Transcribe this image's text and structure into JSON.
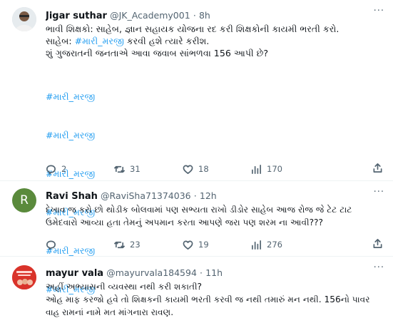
{
  "tweets": [
    {
      "name": "Jigar suthar",
      "handle": "@JK_Academy001",
      "dot": "·",
      "time": "8h",
      "more": "···",
      "lines": [
        "ભાવી શિક્ષકો: સાહેબ, જ્ઞાન સહાયક યોજના રદ કરી શિક્ષકોની કાયમી ભરતી કરો.",
        "શું ગુજરાતની જનતાએ આવા જવાબ સાંભળવા 156 આપી છે?"
      ],
      "line2_prefix": "સાહેબ: ",
      "line2_tag": "#મારી_મરજી",
      "line2_suffix": " કરવી હશે ત્યારે કરીશ.",
      "hashtags": [
        "#મારી_મરજી",
        "#મારી_મરજી",
        "#મારી_મરજી",
        "#મારી_મરજી",
        "#મારી_મરજી",
        "#મારી_મરજી"
      ],
      "replies": "2",
      "retweets": "31",
      "likes": "18",
      "views": "170"
    },
    {
      "name": "Ravi Shah",
      "handle": "@RaviSha71374036",
      "dot": "·",
      "time": "12h",
      "more": "···",
      "avatar_letter": "R",
      "avatar_color": "#5a8a3c",
      "text": "દેખાવ જ કરો છો થોડીક બોલવામાં પણ સભ્યતા રાખો ડીડોર સાહેબ આજ રોજ જે ટેટ ટાટ ઉમેદવારો આવ્યા હતા તેમનું અપમાન કરતા આપણે જરા પણ શરમ ના આવી???",
      "replies": "",
      "retweets": "23",
      "likes": "19",
      "views": "276"
    },
    {
      "name": "mayur vala",
      "handle": "@mayurvala184594",
      "dot": "·",
      "time": "11h",
      "more": "···",
      "avatar_color": "#e0342b",
      "text": "અહીં અભ્યાસની વ્યવસ્થા નથી કરી શકાતી?\nઓહ માફ કરજો હવે તો શિક્ષકની કાયમી ભરતી કરવી જ નથી તમારું મન નથી. 156નો પાવર વાહ રામનાં નામે મત માંગનારા રાવણ."
    }
  ]
}
